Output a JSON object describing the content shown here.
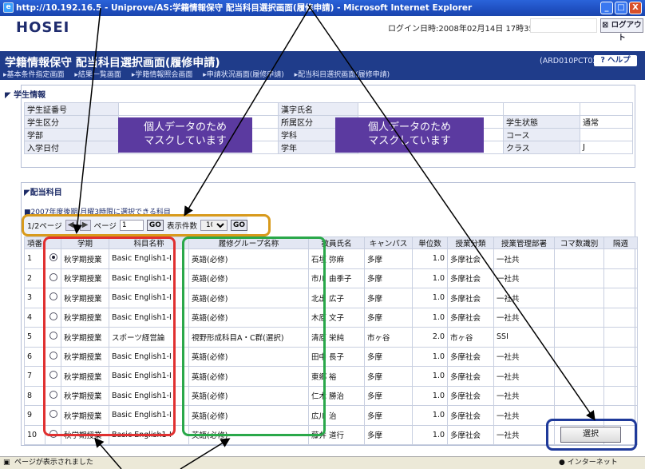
{
  "window": {
    "title": "http://10.192.16.5 - Uniprove/AS:学籍情報保守 配当科目選択画面(履修申請) - Microsoft Internet Explorer",
    "controls": [
      "_",
      "□",
      "X"
    ]
  },
  "header": {
    "logo": "HOSEI",
    "login_time": "ログイン日時:2008年02月14日 17時35分55秒",
    "logout_label": "ログアウト"
  },
  "topbar": {
    "page_title": "学籍情報保守 配当科目選択画面(履修申請)",
    "screen_id": "(ARD010PCT02)",
    "help_label": "ヘルプ",
    "breadcrumbs": [
      "▸基本条件指定画面",
      "▸結果一覧画面",
      "▸学籍情報照会画面",
      "▸申請状況画面(履修申請)",
      "▸配当科目選択画面(履修申請)"
    ]
  },
  "student_info": {
    "title": "学生情報",
    "labels": {
      "student_id": "学生証番号",
      "kanji_name": "漢字氏名",
      "student_type": "学生区分",
      "affiliation": "所属区分",
      "faculty": "学部",
      "department": "学科",
      "admission_date": "入学日付",
      "grade": "学年",
      "status": "学生状態",
      "course": "コース",
      "class": "クラス"
    },
    "values": {
      "status": "通常",
      "class": "J"
    },
    "mask_text": [
      "個人データのため",
      "マスクしています"
    ]
  },
  "courses": {
    "tab_label": "配当科目",
    "note": "2007年度後期 月曜3時限に選択できる科目",
    "pager": {
      "page_indicator": "1/2ページ",
      "page_label": "ページ",
      "page_value": "1",
      "go_label": "GO",
      "count_label": "表示件数",
      "count_value": "10"
    },
    "columns": [
      "項番",
      "",
      "学期",
      "科目名称",
      "履修グループ名称",
      "教員氏名",
      "キャンパス",
      "単位数",
      "授業分類",
      "授業管理部署",
      "コマ数識別",
      "隔週"
    ],
    "rows": [
      {
        "no": "1",
        "selected": true,
        "term": "秋学期授業",
        "subject": "Basic English1-I",
        "group": "英語(必修)",
        "teacher": "石垣 弥麻",
        "campus": "多摩",
        "credits": "1.0",
        "class_type": "多摩社会",
        "dept": "一社共"
      },
      {
        "no": "2",
        "selected": false,
        "term": "秋学期授業",
        "subject": "Basic English1-I",
        "group": "英語(必修)",
        "teacher": "市川 由季子",
        "campus": "多摩",
        "credits": "1.0",
        "class_type": "多摩社会",
        "dept": "一社共"
      },
      {
        "no": "3",
        "selected": false,
        "term": "秋学期授業",
        "subject": "Basic English1-I",
        "group": "英語(必修)",
        "teacher": "北出 広子",
        "campus": "多摩",
        "credits": "1.0",
        "class_type": "多摩社会",
        "dept": "一社共"
      },
      {
        "no": "4",
        "selected": false,
        "term": "秋学期授業",
        "subject": "Basic English1-I",
        "group": "英語(必修)",
        "teacher": "木原 文子",
        "campus": "多摩",
        "credits": "1.0",
        "class_type": "多摩社会",
        "dept": "一社共"
      },
      {
        "no": "5",
        "selected": false,
        "term": "秋学期授業",
        "subject": "スポーツ経営論",
        "group": "視野形成科目A・C群(選択)",
        "teacher": "清原 栄純",
        "campus": "市ヶ谷",
        "credits": "2.0",
        "class_type": "市ヶ谷",
        "dept": "SSI"
      },
      {
        "no": "6",
        "selected": false,
        "term": "秋学期授業",
        "subject": "Basic English1-I",
        "group": "英語(必修)",
        "teacher": "田中 長子",
        "campus": "多摩",
        "credits": "1.0",
        "class_type": "多摩社会",
        "dept": "一社共"
      },
      {
        "no": "7",
        "selected": false,
        "term": "秋学期授業",
        "subject": "Basic English1-I",
        "group": "英語(必修)",
        "teacher": "東郷 裕",
        "campus": "多摩",
        "credits": "1.0",
        "class_type": "多摩社会",
        "dept": "一社共"
      },
      {
        "no": "8",
        "selected": false,
        "term": "秋学期授業",
        "subject": "Basic English1-I",
        "group": "英語(必修)",
        "teacher": "仁木 勝治",
        "campus": "多摩",
        "credits": "1.0",
        "class_type": "多摩社会",
        "dept": "一社共"
      },
      {
        "no": "9",
        "selected": false,
        "term": "秋学期授業",
        "subject": "Basic English1-I",
        "group": "英語(必修)",
        "teacher": "広川 治",
        "campus": "多摩",
        "credits": "1.0",
        "class_type": "多摩社会",
        "dept": "一社共"
      },
      {
        "no": "10",
        "selected": false,
        "term": "秋学期授業",
        "subject": "Basic English1-I",
        "group": "英語(必修)",
        "teacher": "藤井 道行",
        "campus": "多摩",
        "credits": "1.0",
        "class_type": "多摩社会",
        "dept": "一社共"
      }
    ],
    "select_label": "選択"
  },
  "statusbar": {
    "message": "ページが表示されました",
    "zone": "インターネット"
  },
  "annotation_colors": {
    "pager_box": "#d89a1c",
    "term_box": "#e03030",
    "group_box": "#2aa84a",
    "select_box": "#1f3a9a",
    "arrow": "#000000"
  }
}
